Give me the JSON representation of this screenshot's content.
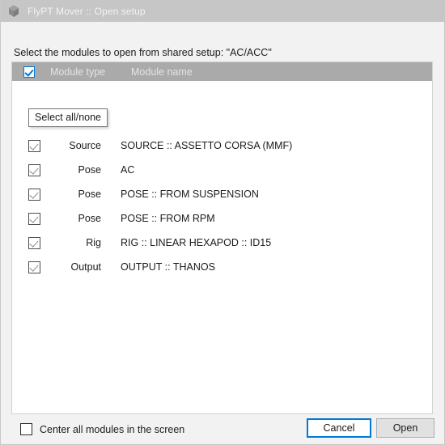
{
  "titlebar": {
    "icon": "app-logo-icon",
    "title": "FlyPT Mover :: Open setup"
  },
  "dialog": {
    "instruction": "Select the modules to open from shared setup: \"AC/ACC\""
  },
  "list": {
    "headers": {
      "select_all_checkbox_state": "checked",
      "type": "Module type",
      "name": "Module name"
    },
    "tooltip": "Select all/none",
    "rows": [
      {
        "checked": true,
        "type": "",
        "name": ""
      },
      {
        "checked": true,
        "type": "Source",
        "name": "SOURCE :: ASSETTO CORSA (MMF)"
      },
      {
        "checked": true,
        "type": "Pose",
        "name": "AC"
      },
      {
        "checked": true,
        "type": "Pose",
        "name": "POSE :: FROM SUSPENSION"
      },
      {
        "checked": true,
        "type": "Pose",
        "name": "POSE :: FROM RPM"
      },
      {
        "checked": true,
        "type": "Rig",
        "name": "RIG :: LINEAR HEXAPOD :: ID15"
      },
      {
        "checked": true,
        "type": "Output",
        "name": "OUTPUT :: THANOS"
      }
    ]
  },
  "footer": {
    "center_checkbox_label": "Center all modules in the screen",
    "center_checkbox_state": "unchecked",
    "cancel_label": "Cancel",
    "open_label": "Open"
  },
  "colors": {
    "accent": "#0078d7",
    "titlebar": "#c6c6c6",
    "header_band": "#aaaaaa",
    "dialog_bg": "#f2f2f2",
    "panel_bg": "#ffffff"
  }
}
